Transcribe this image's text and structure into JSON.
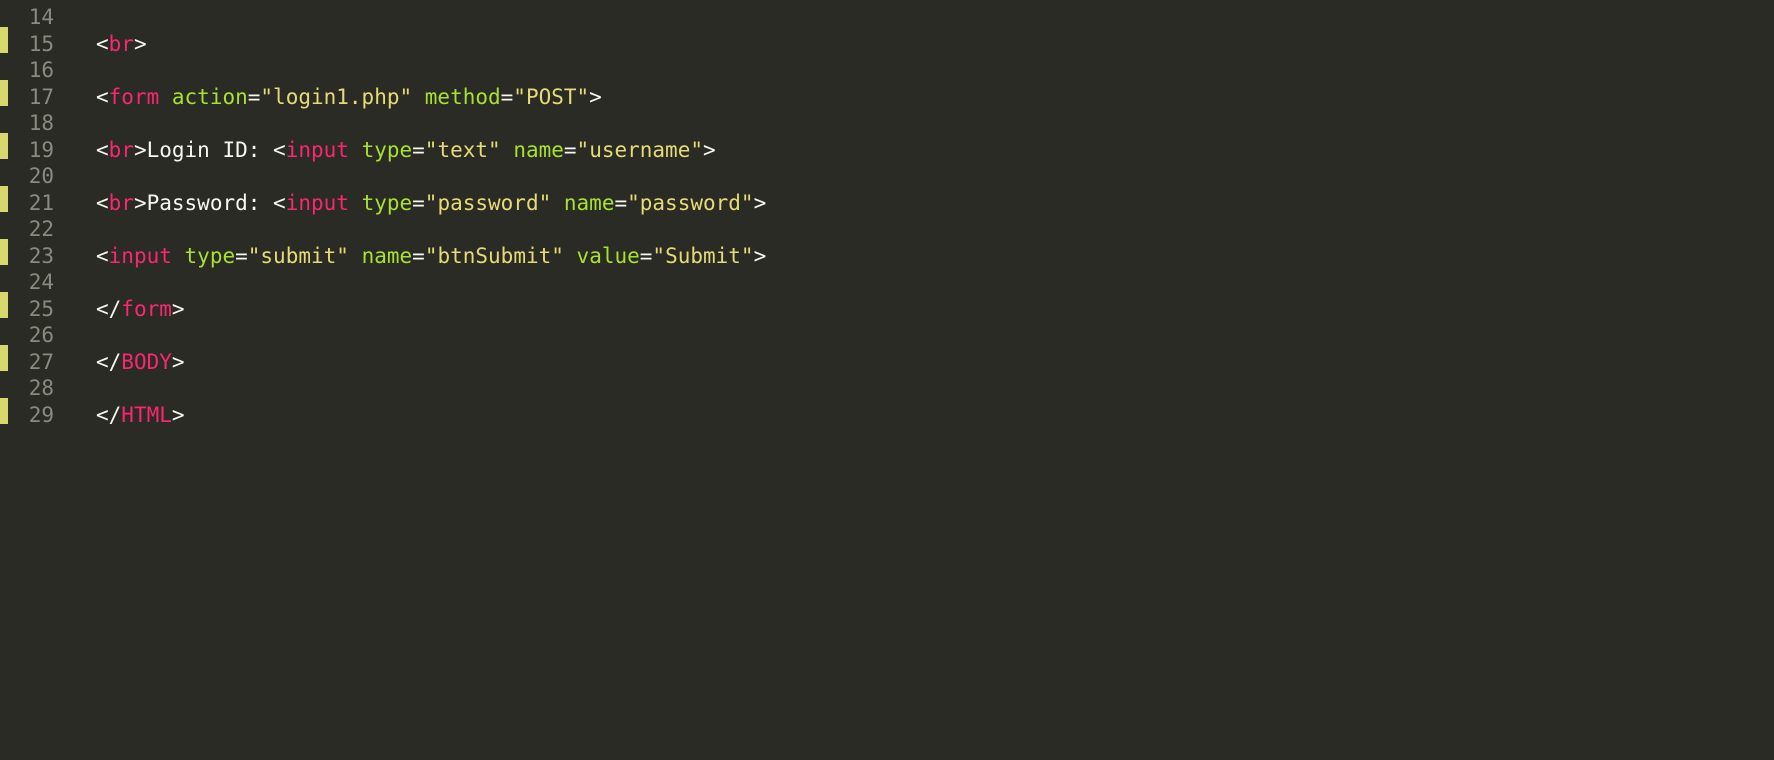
{
  "gutter": {
    "start": 14,
    "end": 29
  },
  "modified_lines": [
    15,
    17,
    19,
    21,
    23,
    25,
    27,
    29
  ],
  "code_lines": {
    "14": [],
    "15": [
      {
        "cls": "p",
        "t": "<"
      },
      {
        "cls": "tg",
        "t": "br"
      },
      {
        "cls": "p",
        "t": ">"
      }
    ],
    "16": [],
    "17": [
      {
        "cls": "p",
        "t": "<"
      },
      {
        "cls": "tg",
        "t": "form"
      },
      {
        "cls": "p",
        "t": " "
      },
      {
        "cls": "at",
        "t": "action"
      },
      {
        "cls": "p",
        "t": "="
      },
      {
        "cls": "st",
        "t": "\"login1.php\""
      },
      {
        "cls": "p",
        "t": " "
      },
      {
        "cls": "at",
        "t": "method"
      },
      {
        "cls": "p",
        "t": "="
      },
      {
        "cls": "st",
        "t": "\"POST\""
      },
      {
        "cls": "p",
        "t": ">"
      }
    ],
    "18": [],
    "19": [
      {
        "cls": "p",
        "t": "<"
      },
      {
        "cls": "tg",
        "t": "br"
      },
      {
        "cls": "p",
        "t": ">"
      },
      {
        "cls": "p",
        "t": "Login ID: <"
      },
      {
        "cls": "tg",
        "t": "input"
      },
      {
        "cls": "p",
        "t": " "
      },
      {
        "cls": "at",
        "t": "type"
      },
      {
        "cls": "p",
        "t": "="
      },
      {
        "cls": "st",
        "t": "\"text\""
      },
      {
        "cls": "p",
        "t": " "
      },
      {
        "cls": "at",
        "t": "name"
      },
      {
        "cls": "p",
        "t": "="
      },
      {
        "cls": "st",
        "t": "\"username\""
      },
      {
        "cls": "p",
        "t": ">"
      }
    ],
    "20": [],
    "21": [
      {
        "cls": "p",
        "t": "<"
      },
      {
        "cls": "tg",
        "t": "br"
      },
      {
        "cls": "p",
        "t": ">"
      },
      {
        "cls": "p",
        "t": "Password: <"
      },
      {
        "cls": "tg",
        "t": "input"
      },
      {
        "cls": "p",
        "t": " "
      },
      {
        "cls": "at",
        "t": "type"
      },
      {
        "cls": "p",
        "t": "="
      },
      {
        "cls": "st",
        "t": "\"password\""
      },
      {
        "cls": "p",
        "t": " "
      },
      {
        "cls": "at",
        "t": "name"
      },
      {
        "cls": "p",
        "t": "="
      },
      {
        "cls": "st",
        "t": "\"password\""
      },
      {
        "cls": "p",
        "t": ">"
      }
    ],
    "22": [],
    "23": [
      {
        "cls": "p",
        "t": "<"
      },
      {
        "cls": "tg",
        "t": "input"
      },
      {
        "cls": "p",
        "t": " "
      },
      {
        "cls": "at",
        "t": "type"
      },
      {
        "cls": "p",
        "t": "="
      },
      {
        "cls": "st",
        "t": "\"submit\""
      },
      {
        "cls": "p",
        "t": " "
      },
      {
        "cls": "at",
        "t": "name"
      },
      {
        "cls": "p",
        "t": "="
      },
      {
        "cls": "st",
        "t": "\"btnSubmit\""
      },
      {
        "cls": "p",
        "t": " "
      },
      {
        "cls": "at",
        "t": "value"
      },
      {
        "cls": "p",
        "t": "="
      },
      {
        "cls": "st",
        "t": "\"Submit\""
      },
      {
        "cls": "p",
        "t": ">"
      }
    ],
    "24": [],
    "25": [
      {
        "cls": "p",
        "t": "</"
      },
      {
        "cls": "tg",
        "t": "form"
      },
      {
        "cls": "p",
        "t": ">"
      }
    ],
    "26": [],
    "27": [
      {
        "cls": "p",
        "t": "</"
      },
      {
        "cls": "tg",
        "t": "BODY"
      },
      {
        "cls": "p",
        "t": ">"
      }
    ],
    "28": [],
    "29": [
      {
        "cls": "p",
        "t": "</"
      },
      {
        "cls": "tg",
        "t": "HTML"
      },
      {
        "cls": "p",
        "t": ">"
      }
    ]
  }
}
